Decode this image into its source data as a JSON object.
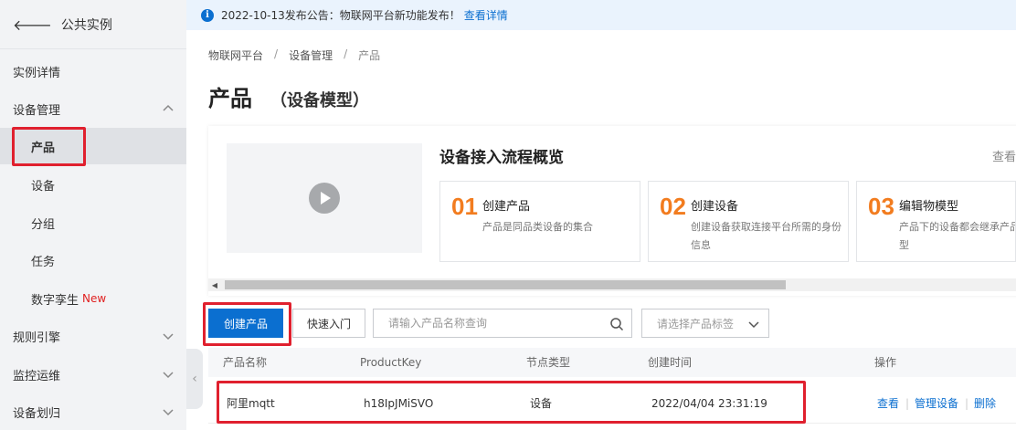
{
  "sidebar": {
    "back_label": "公共实例",
    "items": [
      {
        "label": "实例详情"
      },
      {
        "label": "设备管理"
      },
      {
        "label": "产品"
      },
      {
        "label": "设备"
      },
      {
        "label": "分组"
      },
      {
        "label": "任务"
      },
      {
        "label": "数字孪生",
        "badge": "New"
      },
      {
        "label": "规则引擎"
      },
      {
        "label": "监控运维"
      },
      {
        "label": "设备划归"
      }
    ]
  },
  "notice": {
    "text": "2022-10-13发布公告：物联网平台新功能发布！",
    "link": "查看详情"
  },
  "breadcrumb": [
    "物联网平台",
    "设备管理",
    "产品"
  ],
  "page": {
    "title": "产品",
    "subtitle": "（设备模型）"
  },
  "overview": {
    "title": "设备接入流程概览",
    "more": "查看",
    "steps": [
      {
        "num": "01",
        "title": "创建产品",
        "desc": "产品是同品类设备的集合"
      },
      {
        "num": "02",
        "title": "创建设备",
        "desc": "创建设备获取连接平台所需的身份信息"
      },
      {
        "num": "03",
        "title": "编辑物模型",
        "desc": "产品下的设备都会继承产品的物模型"
      }
    ]
  },
  "toolbar": {
    "create_label": "创建产品",
    "quickstart_label": "快速入门",
    "search_placeholder": "请输入产品名称查询",
    "tag_placeholder": "请选择产品标签"
  },
  "table": {
    "columns": [
      "产品名称",
      "ProductKey",
      "节点类型",
      "创建时间",
      "操作"
    ],
    "rows": [
      {
        "name": "阿里mqtt",
        "key": "h18IpJMiSVO",
        "node_type": "设备",
        "created": "2022/04/04 23:31:19",
        "ops": [
          "查看",
          "管理设备",
          "删除"
        ]
      }
    ]
  },
  "colors": {
    "primary": "#0b6fd0",
    "highlight": "#e0202e",
    "step_number": "#f27c1f"
  }
}
